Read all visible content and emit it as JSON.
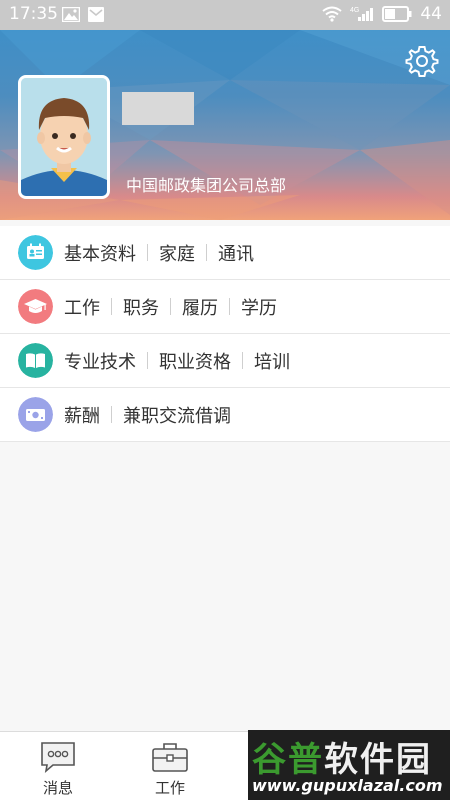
{
  "status_bar": {
    "time": "17:35",
    "battery_level": "44",
    "network_label": "4G"
  },
  "header": {
    "org_name": "中国邮政集团公司总部"
  },
  "menu": [
    {
      "icon": "id-card-icon",
      "color": "#3ec6e0",
      "items": [
        "基本资料",
        "家庭",
        "通讯"
      ]
    },
    {
      "icon": "graduation-cap-icon",
      "color": "#f27b7f",
      "items": [
        "工作",
        "职务",
        "履历",
        "学历"
      ]
    },
    {
      "icon": "book-icon",
      "color": "#27b3a0",
      "items": [
        "专业技术",
        "职业资格",
        "培训"
      ]
    },
    {
      "icon": "money-icon",
      "color": "#9aa3e8",
      "items": [
        "薪酬",
        "兼职交流借调"
      ]
    }
  ],
  "tabs": [
    {
      "label": "消息",
      "icon": "message-icon"
    },
    {
      "label": "工作",
      "icon": "briefcase-icon"
    }
  ],
  "watermark": {
    "title_part1": "谷普",
    "title_part2": "软件园",
    "url": "www.gupuxlazal.com"
  }
}
